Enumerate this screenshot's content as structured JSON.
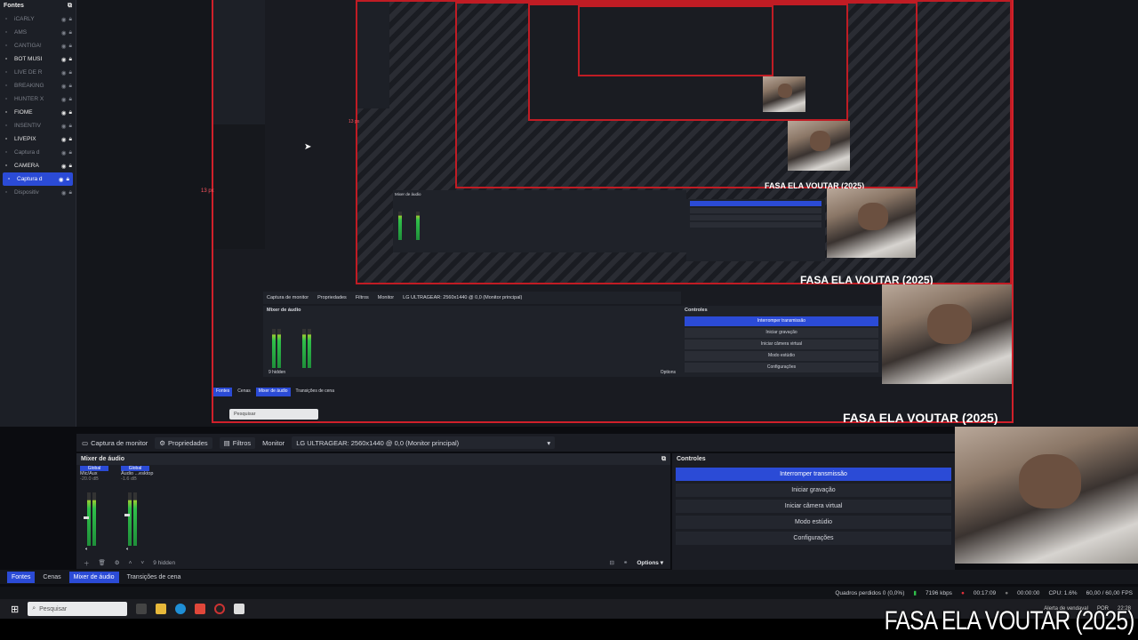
{
  "sources": {
    "title": "Fontes",
    "items": [
      {
        "label": "iCARLY",
        "active": false
      },
      {
        "label": "AMS",
        "active": false
      },
      {
        "label": "CANTIGA!",
        "active": false
      },
      {
        "label": "BOT MUSI",
        "active": true
      },
      {
        "label": "LIVE DE R",
        "active": false
      },
      {
        "label": "BREAKING",
        "active": false
      },
      {
        "label": "HUNTER X",
        "active": false
      },
      {
        "label": "FIOME",
        "active": true
      },
      {
        "label": "INSENTIV",
        "active": false
      },
      {
        "label": "LIVEPIX",
        "active": true
      },
      {
        "label": "Captura d",
        "active": false
      },
      {
        "label": "CAMERA",
        "active": true
      },
      {
        "label": "Captura d",
        "active": true,
        "selected": true
      },
      {
        "label": "Dispositiv",
        "active": false
      }
    ]
  },
  "preview": {
    "spacing_label_left": "13 px",
    "spacing_label_inner": "13 px",
    "nested_search": "Pesquisar",
    "nested_monitor": "LG ULTRAGEAR: 2560x1440 @ 0,0 (Monitor principal)",
    "nested_hidden": "9 hidden",
    "nested_options": "Options",
    "nested_tabs": [
      "Fontes",
      "Cenas",
      "Mixer de áudio",
      "Transições de cena"
    ],
    "nested_controls_title": "Controles",
    "nested_controls": [
      "Interromper transmissão",
      "Iniciar gravação",
      "Iniciar câmera virtual",
      "Modo estúdio",
      "Configurações"
    ],
    "nested_mixer_title": "Mixer de áudio",
    "nested_capture": "Captura de monitor",
    "nested_props": "Propriedades",
    "nested_filters": "Filtros",
    "nested_monitor_label": "Monitor",
    "overlay_text": "FASA ELA VOUTAR (2025)"
  },
  "toolbar": {
    "capture_label": "Captura de monitor",
    "properties_label": "Propriedades",
    "filters_label": "Filtros",
    "monitor_label": "Monitor",
    "monitor_value": "LG ULTRAGEAR: 2560x1440 @ 0,0 (Monitor principal)"
  },
  "mixer": {
    "title": "Mixer de áudio",
    "channels": [
      {
        "tag": "Global",
        "name": "Mic/Aux",
        "db": "-20.0 dB",
        "level": 0.55
      },
      {
        "tag": "Global",
        "name": "Áudio ...esktop",
        "db": "-1.6 dB",
        "level": 0.6
      }
    ],
    "scale": [
      "0",
      "-6",
      "-12",
      "-18",
      "-24",
      "-30",
      "-36",
      "-42",
      "-48",
      "-54",
      "-60"
    ],
    "hidden_label": "9 hidden",
    "options_label": "Options"
  },
  "controls": {
    "title": "Controles",
    "buttons": [
      {
        "label": "Interromper transmissão",
        "active": true
      },
      {
        "label": "Iniciar gravação",
        "active": false
      },
      {
        "label": "Iniciar câmera virtual",
        "active": false
      },
      {
        "label": "Modo estúdio",
        "active": false
      },
      {
        "label": "Configurações",
        "active": false
      }
    ]
  },
  "docks": [
    "Fontes",
    "Cenas",
    "Mixer de áudio",
    "Transições de cena"
  ],
  "status": {
    "frames_dropped": "Quadros perdidos 0 (0,0%)",
    "bitrate": "7196 kbps",
    "stream_time": "00:17:09",
    "rec_time": "00:00:00",
    "cpu": "CPU: 1.6%",
    "fps": "60,00 / 60,00 FPS"
  },
  "taskbar": {
    "search_placeholder": "Pesquisar",
    "weather": "Alerta de vendaval",
    "lang": "POR",
    "time": "22:28"
  },
  "caption": "FASA ELA VOUTAR (2025)",
  "colors": {
    "accent": "#2b4bd6",
    "border_red": "#d0202a",
    "background": "#14161b"
  }
}
